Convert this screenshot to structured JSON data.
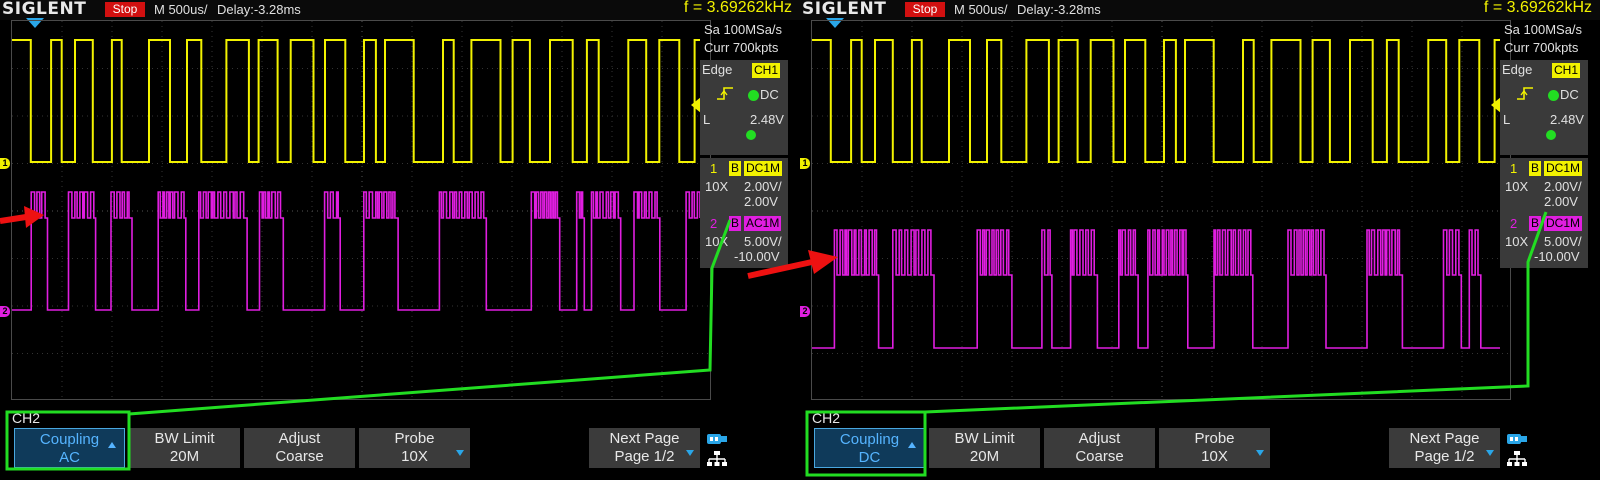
{
  "scope": {
    "brand": "SIGLENT",
    "status": "Stop",
    "timebase": "M 500us/",
    "delay": "Delay:-3.28ms",
    "frequency": "f = 3.69262kHz",
    "sample_rate": "Sa 100MSa/s",
    "memory_depth": "Curr 700kpts",
    "trigger": {
      "type": "Edge",
      "source": "CH1",
      "coupling": "DC",
      "level_label": "L",
      "level": "2.48V"
    },
    "ch1": {
      "num": "1",
      "bw_flag": "B",
      "coupling_impedance": "DC1M",
      "probe": "10X",
      "scale": "2.00V/",
      "offset": "2.00V",
      "marker": "1"
    }
  },
  "panels": [
    {
      "id": "left",
      "ch2": {
        "num": "2",
        "bw_flag": "B",
        "coupling_impedance": "AC1M",
        "probe": "10X",
        "scale": "5.00V/",
        "offset": "-10.00V",
        "marker": "2"
      },
      "menu": {
        "title": "CH2",
        "coupling_label": "Coupling",
        "coupling_value": "AC",
        "bw_label": "BW Limit",
        "bw_value": "20M",
        "adjust_label": "Adjust",
        "adjust_value": "Coarse",
        "probe_label": "Probe",
        "probe_value": "10X",
        "next_label": "Next Page",
        "next_value": "Page 1/2"
      }
    },
    {
      "id": "right",
      "ch2": {
        "num": "2",
        "bw_flag": "B",
        "coupling_impedance": "DC1M",
        "probe": "10X",
        "scale": "5.00V/",
        "offset": "-10.00V",
        "marker": "2"
      },
      "menu": {
        "title": "CH2",
        "coupling_label": "Coupling",
        "coupling_value": "DC",
        "bw_label": "BW Limit",
        "bw_value": "20M",
        "adjust_label": "Adjust",
        "adjust_value": "Coarse",
        "probe_label": "Probe",
        "probe_value": "10X",
        "next_label": "Next Page",
        "next_value": "Page 1/2"
      }
    }
  ],
  "colors": {
    "ch1": "#f2f200",
    "ch2": "#e01ee0",
    "annotation_box": "#22dd22",
    "annotation_arrow": "#ee1111",
    "active_button": "#55b4ff"
  },
  "icons": [
    "usb-icon",
    "network-icon",
    "trigger-edge-icon",
    "trigger-position-icon"
  ]
}
